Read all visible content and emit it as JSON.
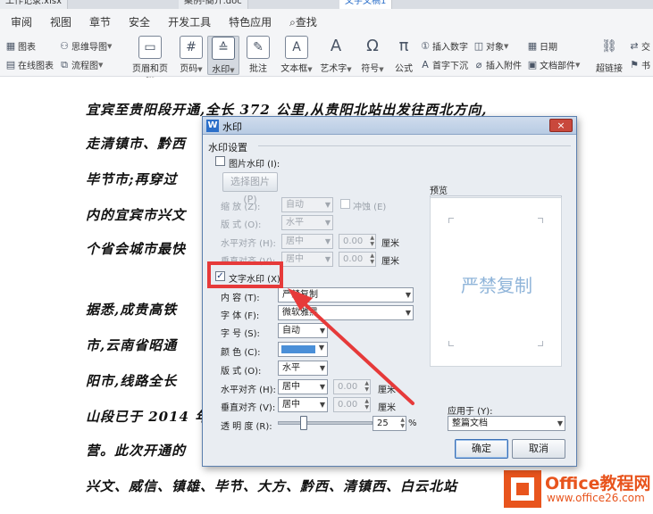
{
  "tabs": [
    {
      "label": "工作记录.xlsx",
      "active": false
    },
    {
      "label": "案例-簡介.doc",
      "active": false
    },
    {
      "label": "文字文稿1",
      "active": true
    }
  ],
  "menu": [
    "审阅",
    "视图",
    "章节",
    "安全",
    "开发工具",
    "特色应用",
    "查找"
  ],
  "ribbon": {
    "chart": "图表",
    "mindmap": "思维导图",
    "online_chart": "在线图表",
    "flowchart": "流程图",
    "header_footer": "页眉和页脚",
    "page_number": "页码",
    "watermark": "水印",
    "annotation": "批注",
    "textbox": "文本框",
    "wordart": "艺术字",
    "symbol": "符号",
    "formula": "公式",
    "insert_number": "插入数字",
    "object": "对象",
    "drop_cap": "首字下沉",
    "insert_attachment": "插入附件",
    "date": "日期",
    "doc_parts": "文档部件",
    "hyperlink": "超链接",
    "crossref": "交",
    "bookmark": "书"
  },
  "document": {
    "lines": [
      "宜宾至贵阳段开通,全长 372 公里,从贵阳北站出发往西北方向,",
      "走清镇市、黔西",
      "毕节市;再穿过",
      "内的宜宾市兴文",
      "个省会城市最快",
      "据悉,成贵高铁",
      "市,云南省昭通",
      "阳市,线路全长",
      "山段已于 2014 年",
      "营。此次开通的",
      "兴文、威信、镇雄、毕节、大方、黔西、清镇西、白云北站",
      "……………………"
    ]
  },
  "logo": {
    "title": "Office教程网",
    "url": "www.office26.com"
  },
  "dialog": {
    "title": "水印",
    "close": "×",
    "section": "水印设置",
    "picture_wm": {
      "label": "图片水印 (I):",
      "checked": false
    },
    "select_picture": "选择图片 (P)",
    "scale": {
      "label": "缩  放 (Z):",
      "value": "自动"
    },
    "washout": "冲蚀 (E)",
    "pic_layout": {
      "label": "版  式 (O):",
      "value": "水平"
    },
    "pic_halign": {
      "label": "水平对齐 (H):",
      "value": "居中",
      "num": "0.00",
      "unit": "厘米"
    },
    "pic_valign": {
      "label": "垂直对齐 (V):",
      "value": "居中",
      "num": "0.00",
      "unit": "厘米"
    },
    "text_wm": {
      "label": "文字水印 (X)",
      "checked": true
    },
    "content": {
      "label": "内  容 (T):",
      "value": "严禁复制"
    },
    "font": {
      "label": "字  体 (F):",
      "value": "微软雅黑"
    },
    "size": {
      "label": "字  号 (S):",
      "value": "自动"
    },
    "color": {
      "label": "颜  色 (C):",
      "value": "#4a8fd8"
    },
    "layout": {
      "label": "版  式 (O):",
      "value": "水平"
    },
    "halign": {
      "label": "水平对齐 (H):",
      "value": "居中",
      "num": "0.00",
      "unit": "厘米"
    },
    "valign": {
      "label": "垂直对齐 (V):",
      "value": "居中",
      "num": "0.00",
      "unit": "厘米"
    },
    "transparency": {
      "label": "透 明 度 (R):",
      "value": "25",
      "unit": "%",
      "level": 0.25
    },
    "preview_label": "预览",
    "preview_text": "严禁复制",
    "apply_to": {
      "label": "应用于 (Y):",
      "value": "整篇文档"
    },
    "ok": "确定",
    "cancel": "取消"
  },
  "annotation_color": "#e63a3a"
}
